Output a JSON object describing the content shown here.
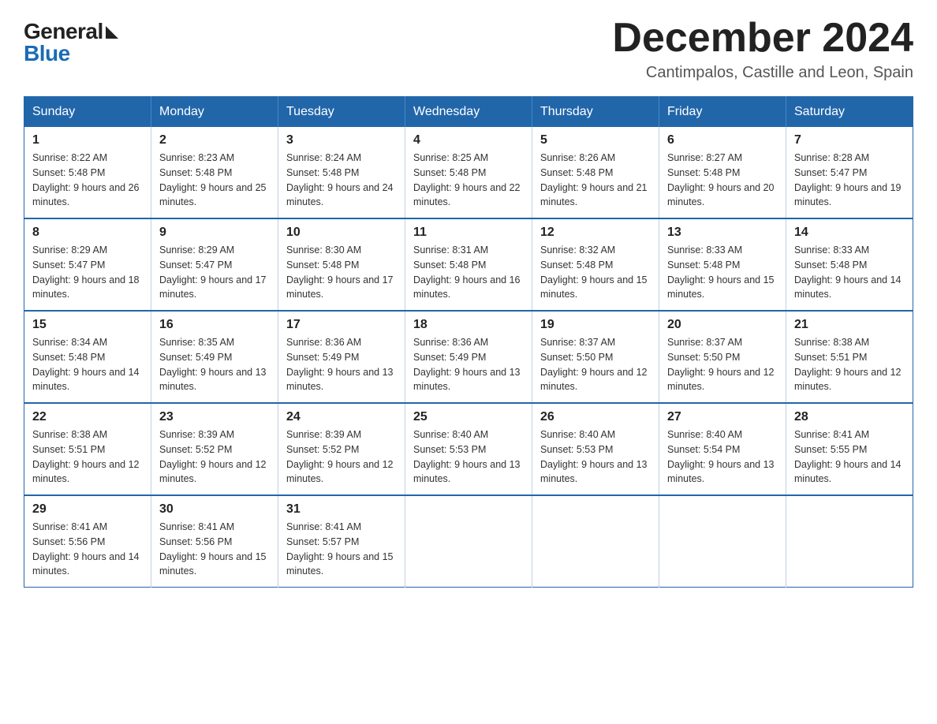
{
  "logo": {
    "general": "General",
    "blue": "Blue"
  },
  "header": {
    "month": "December 2024",
    "location": "Cantimpalos, Castille and Leon, Spain"
  },
  "weekdays": [
    "Sunday",
    "Monday",
    "Tuesday",
    "Wednesday",
    "Thursday",
    "Friday",
    "Saturday"
  ],
  "weeks": [
    [
      {
        "day": "1",
        "sunrise": "8:22 AM",
        "sunset": "5:48 PM",
        "daylight": "9 hours and 26 minutes."
      },
      {
        "day": "2",
        "sunrise": "8:23 AM",
        "sunset": "5:48 PM",
        "daylight": "9 hours and 25 minutes."
      },
      {
        "day": "3",
        "sunrise": "8:24 AM",
        "sunset": "5:48 PM",
        "daylight": "9 hours and 24 minutes."
      },
      {
        "day": "4",
        "sunrise": "8:25 AM",
        "sunset": "5:48 PM",
        "daylight": "9 hours and 22 minutes."
      },
      {
        "day": "5",
        "sunrise": "8:26 AM",
        "sunset": "5:48 PM",
        "daylight": "9 hours and 21 minutes."
      },
      {
        "day": "6",
        "sunrise": "8:27 AM",
        "sunset": "5:48 PM",
        "daylight": "9 hours and 20 minutes."
      },
      {
        "day": "7",
        "sunrise": "8:28 AM",
        "sunset": "5:47 PM",
        "daylight": "9 hours and 19 minutes."
      }
    ],
    [
      {
        "day": "8",
        "sunrise": "8:29 AM",
        "sunset": "5:47 PM",
        "daylight": "9 hours and 18 minutes."
      },
      {
        "day": "9",
        "sunrise": "8:29 AM",
        "sunset": "5:47 PM",
        "daylight": "9 hours and 17 minutes."
      },
      {
        "day": "10",
        "sunrise": "8:30 AM",
        "sunset": "5:48 PM",
        "daylight": "9 hours and 17 minutes."
      },
      {
        "day": "11",
        "sunrise": "8:31 AM",
        "sunset": "5:48 PM",
        "daylight": "9 hours and 16 minutes."
      },
      {
        "day": "12",
        "sunrise": "8:32 AM",
        "sunset": "5:48 PM",
        "daylight": "9 hours and 15 minutes."
      },
      {
        "day": "13",
        "sunrise": "8:33 AM",
        "sunset": "5:48 PM",
        "daylight": "9 hours and 15 minutes."
      },
      {
        "day": "14",
        "sunrise": "8:33 AM",
        "sunset": "5:48 PM",
        "daylight": "9 hours and 14 minutes."
      }
    ],
    [
      {
        "day": "15",
        "sunrise": "8:34 AM",
        "sunset": "5:48 PM",
        "daylight": "9 hours and 14 minutes."
      },
      {
        "day": "16",
        "sunrise": "8:35 AM",
        "sunset": "5:49 PM",
        "daylight": "9 hours and 13 minutes."
      },
      {
        "day": "17",
        "sunrise": "8:36 AM",
        "sunset": "5:49 PM",
        "daylight": "9 hours and 13 minutes."
      },
      {
        "day": "18",
        "sunrise": "8:36 AM",
        "sunset": "5:49 PM",
        "daylight": "9 hours and 13 minutes."
      },
      {
        "day": "19",
        "sunrise": "8:37 AM",
        "sunset": "5:50 PM",
        "daylight": "9 hours and 12 minutes."
      },
      {
        "day": "20",
        "sunrise": "8:37 AM",
        "sunset": "5:50 PM",
        "daylight": "9 hours and 12 minutes."
      },
      {
        "day": "21",
        "sunrise": "8:38 AM",
        "sunset": "5:51 PM",
        "daylight": "9 hours and 12 minutes."
      }
    ],
    [
      {
        "day": "22",
        "sunrise": "8:38 AM",
        "sunset": "5:51 PM",
        "daylight": "9 hours and 12 minutes."
      },
      {
        "day": "23",
        "sunrise": "8:39 AM",
        "sunset": "5:52 PM",
        "daylight": "9 hours and 12 minutes."
      },
      {
        "day": "24",
        "sunrise": "8:39 AM",
        "sunset": "5:52 PM",
        "daylight": "9 hours and 12 minutes."
      },
      {
        "day": "25",
        "sunrise": "8:40 AM",
        "sunset": "5:53 PM",
        "daylight": "9 hours and 13 minutes."
      },
      {
        "day": "26",
        "sunrise": "8:40 AM",
        "sunset": "5:53 PM",
        "daylight": "9 hours and 13 minutes."
      },
      {
        "day": "27",
        "sunrise": "8:40 AM",
        "sunset": "5:54 PM",
        "daylight": "9 hours and 13 minutes."
      },
      {
        "day": "28",
        "sunrise": "8:41 AM",
        "sunset": "5:55 PM",
        "daylight": "9 hours and 14 minutes."
      }
    ],
    [
      {
        "day": "29",
        "sunrise": "8:41 AM",
        "sunset": "5:56 PM",
        "daylight": "9 hours and 14 minutes."
      },
      {
        "day": "30",
        "sunrise": "8:41 AM",
        "sunset": "5:56 PM",
        "daylight": "9 hours and 15 minutes."
      },
      {
        "day": "31",
        "sunrise": "8:41 AM",
        "sunset": "5:57 PM",
        "daylight": "9 hours and 15 minutes."
      },
      null,
      null,
      null,
      null
    ]
  ]
}
